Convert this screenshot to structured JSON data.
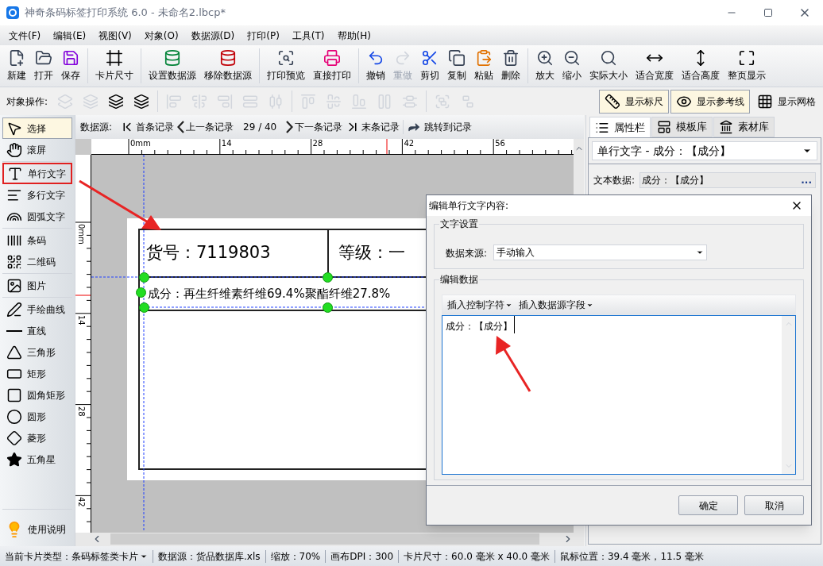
{
  "window": {
    "title": "神奇条码标签打印系统 6.0 - 未命名2.lbcp*"
  },
  "menu": [
    "文件(F)",
    "编辑(E)",
    "视图(V)",
    "对象(O)",
    "数据源(D)",
    "打印(P)",
    "工具(T)",
    "帮助(H)"
  ],
  "toolbar_groups": [
    [
      {
        "kind": "new",
        "label": "新建",
        "disabled": false
      },
      {
        "kind": "open",
        "label": "打开",
        "disabled": false
      },
      {
        "kind": "save",
        "label": "保存",
        "disabled": false
      }
    ],
    [
      {
        "kind": "card-size",
        "label": "卡片尺寸",
        "disabled": false
      }
    ],
    [
      {
        "kind": "set-source",
        "label": "设置数据源",
        "disabled": false
      },
      {
        "kind": "remove-source",
        "label": "移除数据源",
        "disabled": false
      }
    ],
    [
      {
        "kind": "preview",
        "label": "打印预览",
        "disabled": false
      },
      {
        "kind": "print",
        "label": "直接打印",
        "disabled": false
      }
    ],
    [
      {
        "kind": "undo",
        "label": "撤销",
        "disabled": false
      },
      {
        "kind": "redo",
        "label": "重做",
        "disabled": true
      },
      {
        "kind": "cut",
        "label": "剪切",
        "disabled": false
      },
      {
        "kind": "copy",
        "label": "复制",
        "disabled": false
      },
      {
        "kind": "paste",
        "label": "粘贴",
        "disabled": false
      },
      {
        "kind": "delete",
        "label": "删除",
        "disabled": false
      }
    ],
    [
      {
        "kind": "zoom-in",
        "label": "放大",
        "disabled": false
      },
      {
        "kind": "zoom-out",
        "label": "缩小",
        "disabled": false
      },
      {
        "kind": "actual",
        "label": "实际大小",
        "disabled": false
      },
      {
        "kind": "fit-width",
        "label": "适合宽度",
        "disabled": false
      },
      {
        "kind": "fit-height",
        "label": "适合高度",
        "disabled": false
      },
      {
        "kind": "fit-page",
        "label": "整页显示",
        "disabled": false
      }
    ]
  ],
  "object_bar": {
    "label": "对象操作:",
    "groups": [
      [
        {
          "kind": "bring-forward",
          "disabled": true
        },
        {
          "kind": "send-backward",
          "disabled": true
        },
        {
          "kind": "bring-front",
          "disabled": false
        },
        {
          "kind": "send-back",
          "disabled": false
        }
      ],
      [
        {
          "kind": "align-left",
          "disabled": true
        },
        {
          "kind": "align-center",
          "disabled": true
        },
        {
          "kind": "align-right",
          "disabled": true
        },
        {
          "kind": "same-width",
          "disabled": true
        },
        {
          "kind": "distribute-h",
          "disabled": true
        }
      ],
      [
        {
          "kind": "align-top",
          "disabled": true
        },
        {
          "kind": "align-middle",
          "disabled": true
        },
        {
          "kind": "align-bottom",
          "disabled": true
        },
        {
          "kind": "same-height",
          "disabled": true
        },
        {
          "kind": "distribute-v",
          "disabled": true
        }
      ],
      [
        {
          "kind": "group",
          "disabled": true
        },
        {
          "kind": "ungroup",
          "disabled": true
        }
      ]
    ]
  },
  "view_toggles": [
    {
      "kind": "ruler",
      "label": "显示标尺",
      "selected": true
    },
    {
      "kind": "guides",
      "label": "显示参考线",
      "selected": true
    },
    {
      "kind": "grid",
      "label": "显示网格",
      "selected": false
    }
  ],
  "tool_groups": [
    [
      {
        "kind": "select",
        "label": "选择",
        "selected": true,
        "highlighted": false
      },
      {
        "kind": "pan",
        "label": "滚屏",
        "selected": false,
        "highlighted": false
      }
    ],
    [
      {
        "kind": "text",
        "label": "单行文字",
        "selected": false,
        "highlighted": true
      },
      {
        "kind": "multiline",
        "label": "多行文字",
        "selected": false,
        "highlighted": false
      },
      {
        "kind": "arc-text",
        "label": "圆弧文字",
        "selected": false,
        "highlighted": false
      }
    ],
    [
      {
        "kind": "barcode",
        "label": "条码",
        "selected": false,
        "highlighted": false
      },
      {
        "kind": "qrcode",
        "label": "二维码",
        "selected": false,
        "highlighted": false
      }
    ],
    [
      {
        "kind": "image",
        "label": "图片",
        "selected": false,
        "highlighted": false
      }
    ],
    [
      {
        "kind": "pen",
        "label": "手绘曲线",
        "selected": false,
        "highlighted": false
      },
      {
        "kind": "line",
        "label": "直线",
        "selected": false,
        "highlighted": false
      },
      {
        "kind": "triangle",
        "label": "三角形",
        "selected": false,
        "highlighted": false
      },
      {
        "kind": "rect",
        "label": "矩形",
        "selected": false,
        "highlighted": false
      },
      {
        "kind": "round-rect",
        "label": "圆角矩形",
        "selected": false,
        "highlighted": false
      },
      {
        "kind": "circle",
        "label": "圆形",
        "selected": false,
        "highlighted": false
      },
      {
        "kind": "diamond",
        "label": "菱形",
        "selected": false,
        "highlighted": false
      },
      {
        "kind": "star",
        "label": "五角星",
        "selected": false,
        "highlighted": false
      }
    ]
  ],
  "help_button": {
    "label": "使用说明"
  },
  "record_nav": {
    "label": "数据源:",
    "first": "首条记录",
    "prev": "上一条记录",
    "position": "29 / 40",
    "next": "下一条记录",
    "last": "末条记录",
    "jump": "跳转到记录"
  },
  "ruler": {
    "top_labels": [
      "0mm",
      "14",
      "28",
      "42",
      "56"
    ],
    "left_labels": [
      "0mm",
      "14",
      "28",
      "42"
    ]
  },
  "label_card": {
    "cells": [
      "货号：7119803",
      "等级：一"
    ],
    "selected_text": "成分：再生纤维素纤维69.4%聚酯纤维27.8%"
  },
  "right_panel": {
    "tabs": [
      {
        "kind": "properties",
        "label": "属性栏",
        "selected": true
      },
      {
        "kind": "templates",
        "label": "模板库",
        "selected": false
      },
      {
        "kind": "assets",
        "label": "素材库",
        "selected": false
      }
    ],
    "object_select": "单行文字 - 成分：【成分】",
    "text_data_label": "文本数据:",
    "text_data_value": "成分：【成分】",
    "more_button": "..."
  },
  "dialog": {
    "title": "编辑单行文字内容:",
    "text_group": "文字设置",
    "source_label": "数据来源:",
    "source_value": "手动输入",
    "edit_group": "编辑数据",
    "insert_buttons": [
      "插入控制字符",
      "插入数据源字段"
    ],
    "content": "成分：【成分】",
    "ok": "确定",
    "cancel": "取消"
  },
  "status_bar": {
    "card_type": "当前卡片类型：条码标签类卡片",
    "items": [
      "数据源：货品数据库.xls",
      "缩放：70%",
      "画布DPI：300",
      "卡片尺寸：60.0 毫米 x 40.0 毫米",
      "鼠标位置：39.4 毫米，11.5 毫米"
    ]
  }
}
